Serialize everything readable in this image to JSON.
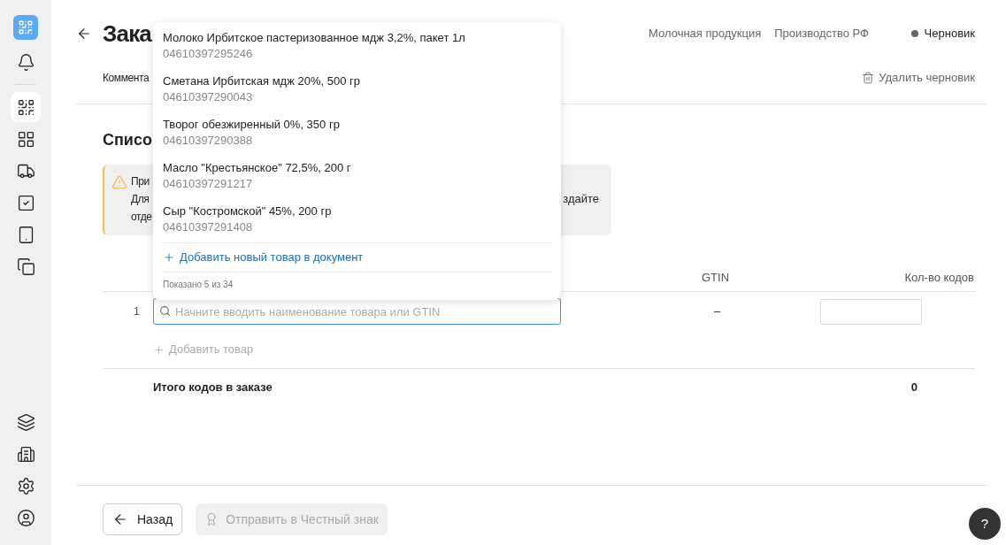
{
  "sidebar": {
    "items": [
      {
        "selected": false
      },
      {
        "selected": true
      },
      {
        "selected": false
      },
      {
        "selected": false
      },
      {
        "selected": false
      },
      {
        "selected": false
      },
      {
        "selected": false
      },
      {
        "selected": false
      },
      {
        "selected": false
      },
      {
        "selected": false
      },
      {
        "selected": false
      }
    ]
  },
  "header": {
    "title": "Зака",
    "tags": [
      "Молочная продукция",
      "Производство РФ"
    ],
    "status": "Черновик",
    "comment_label": "Коммента",
    "delete_draft": "Удалить черновик"
  },
  "section_title": "Списо",
  "warning": {
    "lines": [
      "При",
      "Для",
      "отде"
    ],
    "right_fragment": "здайте"
  },
  "table": {
    "columns": [
      {
        "label": "GTIN"
      },
      {
        "label": "Кол-во кодов"
      }
    ],
    "rows": [
      {
        "number": "1",
        "search": {
          "placeholder": "Начните вводить наименование товара или GTIN"
        },
        "gtin": "–"
      }
    ],
    "add_item": "Добавить товар",
    "total": {
      "label": "Итого кодов в заказе",
      "value": "0"
    }
  },
  "dropdown": {
    "items": [
      {
        "name": "Молоко Ирбитское пастеризованное мдж 3,2%, пакет 1л",
        "gtin": "04610397295246"
      },
      {
        "name": "Сметана Ирбитская мдж 20%, 500 гр",
        "gtin": "04610397290043"
      },
      {
        "name": "Творог обезжиренный 0%, 350 гр",
        "gtin": "04610397290388"
      },
      {
        "name": "Масло \"Крестьянское\" 72,5%, 200 г",
        "gtin": "04610397291217"
      },
      {
        "name": "Сыр \"Костромской\" 45%, 200 гр",
        "gtin": "04610397291408"
      }
    ],
    "add_new": "Добавить новый товар в документ",
    "shown": "Показано 5 из 34"
  },
  "footer": {
    "back": "Назад",
    "send": {
      "label": "Отправить в Честный знак",
      "disabled": true
    }
  },
  "help": "?"
}
